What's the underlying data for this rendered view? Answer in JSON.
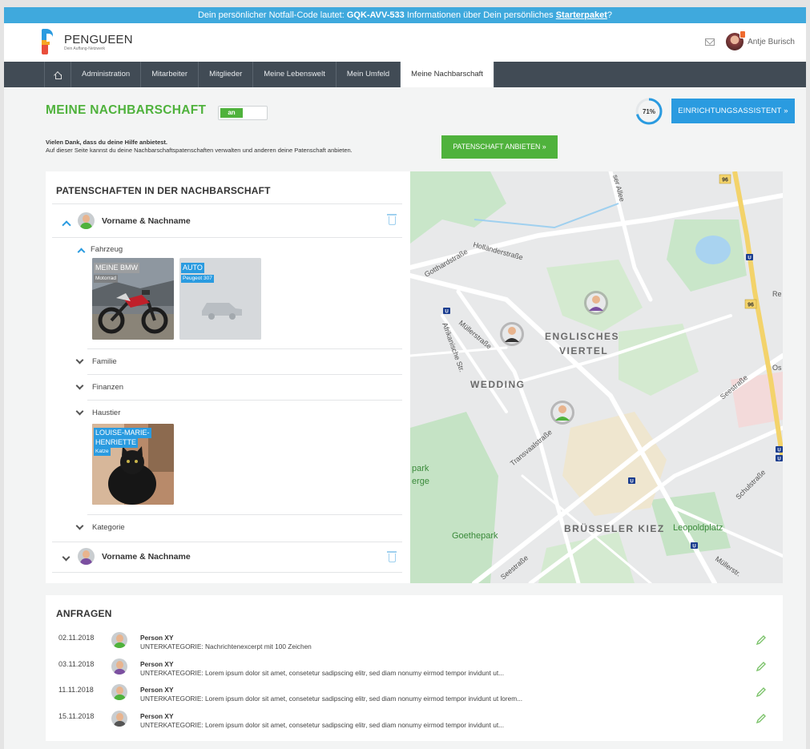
{
  "banner": {
    "prefix": "Dein persönlicher Notfall-Code lautet: ",
    "code": "GQK-AVV-533",
    "middle": " Informationen über Dein persönliches ",
    "link": "Starterpaket",
    "suffix": "?"
  },
  "header": {
    "logo_name": "PENGUEEN",
    "logo_sub": "Dein Auffang-Netzwerk",
    "user_name": "Antje Burisch"
  },
  "nav": {
    "items": [
      "Administration",
      "Mitarbeiter",
      "Mitglieder",
      "Meine Lebenswelt",
      "Mein Umfeld",
      "Meine Nachbarschaft"
    ],
    "active_index": 5
  },
  "page": {
    "title": "MEINE NACHBARSCHAFT",
    "toggle_label": "an",
    "progress_label": "71%",
    "progress_value": 0.71,
    "assistant_button": "EINRICHTUNGSASSISTENT »",
    "intro_line1": "Vielen Dank, dass du deine Hilfe anbietest.",
    "intro_line2": "Auf dieser Seite kannst du deine Nachbarschaftspatenschaften verwalten und anderen deine Patenschaft anbieten.",
    "offer_button": "PATENSCHAFT ANBIETEN »"
  },
  "patenschaften": {
    "title": "PATENSCHAFTEN IN DER NACHBARSCHAFT",
    "person1": "Vorname & Nachname",
    "person2": "Vorname & Nachname",
    "categories": {
      "fahrzeug": "Fahrzeug",
      "familie": "Familie",
      "finanzen": "Finanzen",
      "haustier": "Haustier",
      "kategorie": "Kategorie"
    },
    "cards": {
      "bmw_title": "MEINE BMW",
      "bmw_sub": "Motorrad",
      "auto_title": "AUTO",
      "auto_sub": "Peugeot 307",
      "cat_title1": "LOUISE-MARIE-",
      "cat_title2": "HENRIETTE",
      "cat_sub": "Katze"
    }
  },
  "map": {
    "streets": {
      "seeallee": "ser Allee",
      "gotthardstrasse": "Gotthardstraße",
      "hollaenderstrasse": "Holländerstraße",
      "afrikanische": "Afrikanische Str.",
      "muellerstrasse": "Müllerstraße",
      "transvaalstrasse": "Transvaalstraße",
      "seestrasse": "Seestraße",
      "seestrasse2": "Seestraße",
      "schulstrasse": "Schulstraße",
      "muellerstrasse2": "Müllerstr.",
      "re": "Re",
      "os": "Os"
    },
    "places": {
      "englisches1": "ENGLISCHES",
      "englisches2": "VIERTEL",
      "wedding": "WEDDING",
      "bruesseler": "BRÜSSELER KIEZ",
      "leopoldplatz": "Leopoldplatz",
      "goethepark": "Goethepark",
      "park1": "park",
      "park2": "erge"
    },
    "road_shields": [
      "96",
      "96"
    ],
    "ubahn": "U"
  },
  "anfragen": {
    "title": "ANFRAGEN",
    "rows": [
      {
        "date": "02.11.2018",
        "name": "Person XY",
        "text": "UNTERKATEGORIE: Nachrichtenexcerpt mit 100 Zeichen"
      },
      {
        "date": "03.11.2018",
        "name": "Person XY",
        "text": "UNTERKATEGORIE: Lorem ipsum dolor sit amet, consetetur sadipscing elitr, sed diam nonumy eirmod tempor invidunt ut..."
      },
      {
        "date": "11.11.2018",
        "name": "Person XY",
        "text": "UNTERKATEGORIE: Lorem ipsum dolor sit amet, consetetur sadipscing elitr, sed diam nonumy eirmod tempor invidunt ut lorem..."
      },
      {
        "date": "15.11.2018",
        "name": "Person XY",
        "text": "UNTERKATEGORIE: Lorem ipsum dolor sit amet, consetetur sadipscing elitr, sed diam nonumy eirmod tempor invidunt ut..."
      }
    ]
  },
  "colors": {
    "accent_blue": "#2a9be0",
    "accent_green": "#4fb23c",
    "nav_bg": "#414b55"
  }
}
